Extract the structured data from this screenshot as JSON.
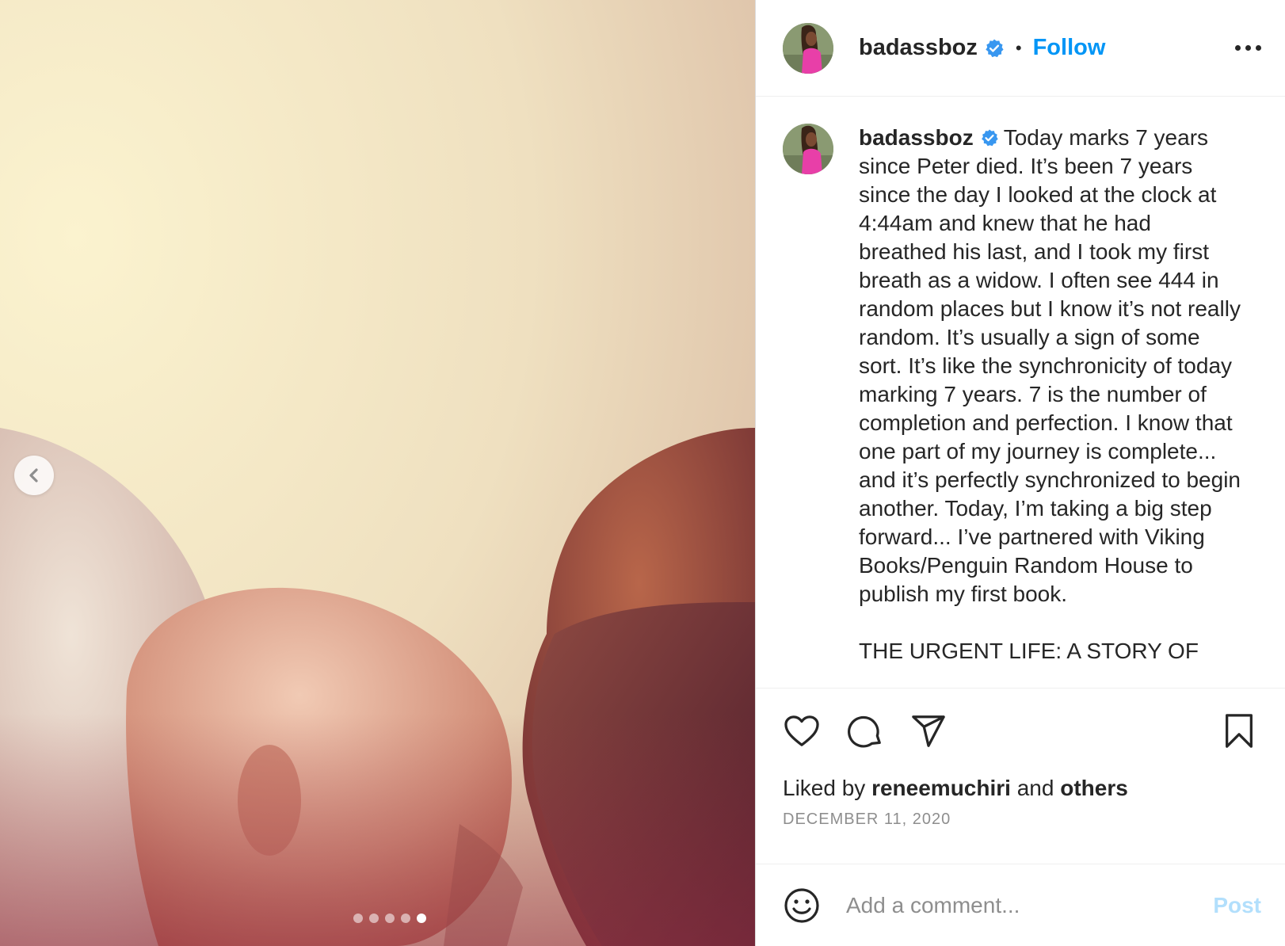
{
  "post": {
    "username": "badassboz",
    "follow_label": "Follow",
    "separator": "•",
    "caption": "Today marks 7 years since Peter died. It’s been 7 years since the day I looked at the clock at 4:44am and knew that he had breathed his last, and I took my first breath as a widow. I often see 444 in random places but I know it’s not really random. It’s usually a sign of some sort. It’s like the synchronicity of today marking 7 years. 7 is the number of completion and perfection. I know that one part of my journey is complete... and it’s perfectly synchronized to begin another. Today, I’m taking a big step forward... I’ve partnered with Viking Books/Penguin Random House to publish my first book.\n\nTHE URGENT LIFE: A STORY OF",
    "liked_by_prefix": "Liked by",
    "liked_by_user": "reneemuchiri",
    "liked_by_and": "and",
    "liked_by_others": "others",
    "date": "DECEMBER 11, 2020"
  },
  "carousel": {
    "slide_count": 5,
    "active_slide": 5
  },
  "comment": {
    "placeholder": "Add a comment...",
    "post_label": "Post"
  },
  "icons": {
    "verified": "verified-badge-icon",
    "more": "more-options-icon",
    "like": "heart-icon",
    "comment": "comment-icon",
    "share": "paper-plane-icon",
    "save": "bookmark-icon",
    "emoji": "smiley-icon",
    "prev": "chevron-left-icon"
  },
  "colors": {
    "link": "#0095f6",
    "verified": "#3897f0",
    "post_disabled": "#b2dffc",
    "muted": "#8e8e8e",
    "text": "#262626"
  }
}
